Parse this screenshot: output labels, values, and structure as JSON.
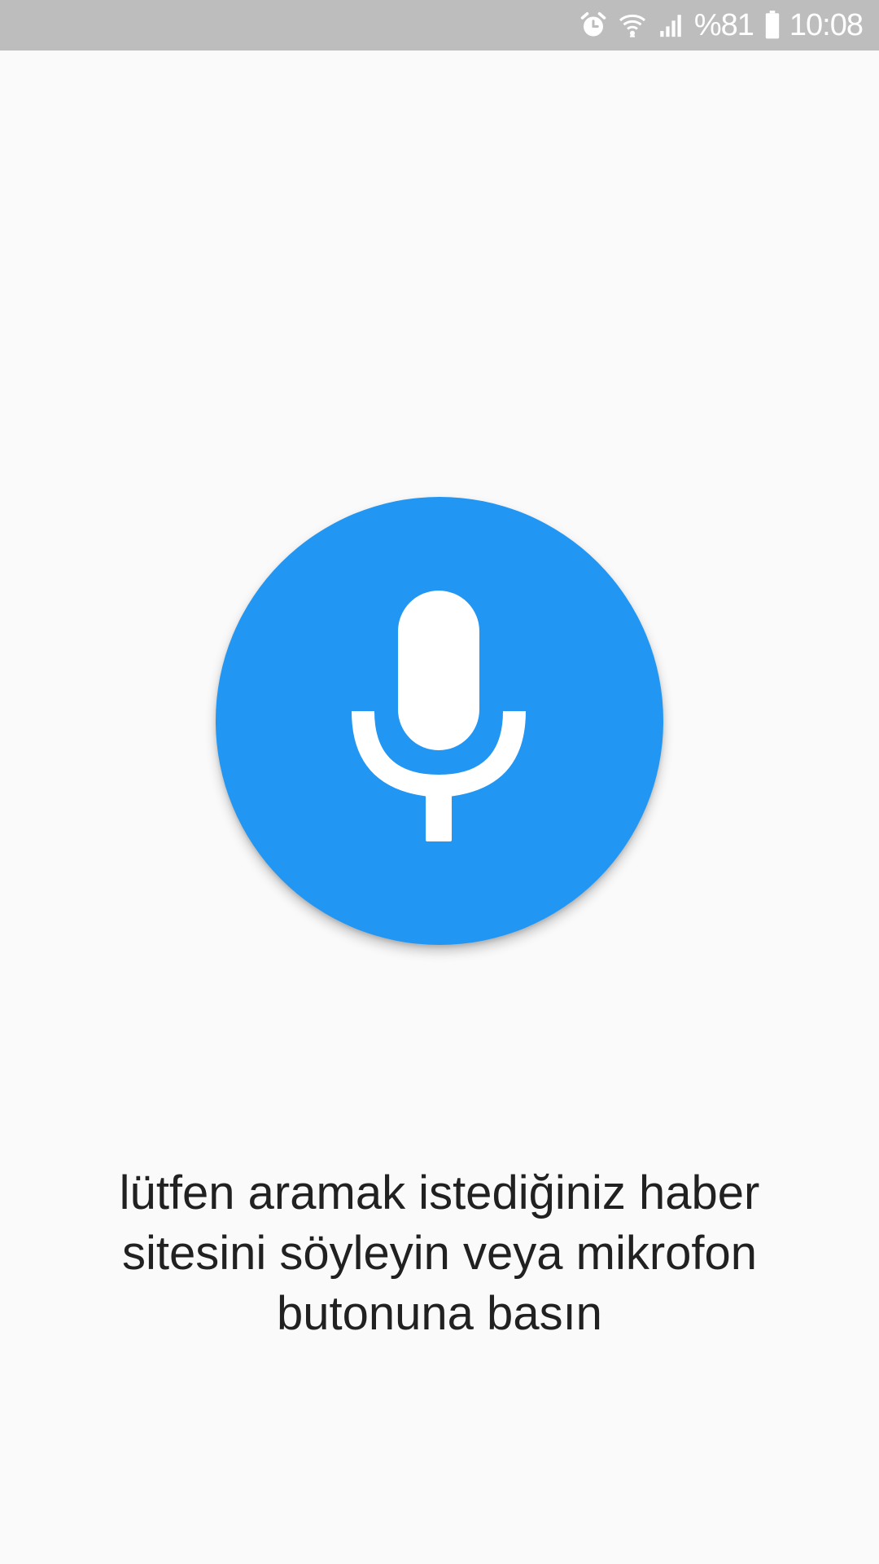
{
  "status_bar": {
    "icons": [
      "alarm-icon",
      "wifi-icon",
      "signal-icon",
      "battery-icon"
    ],
    "battery_percent": "%81",
    "time": "10:08",
    "background_color": "#bdbdbd"
  },
  "main": {
    "mic_button": {
      "icon": "microphone-icon",
      "color": "#2196f3"
    },
    "prompt_text": "lütfen aramak istediğiniz haber sitesini söyleyin veya mikrofon butonuna basın"
  }
}
